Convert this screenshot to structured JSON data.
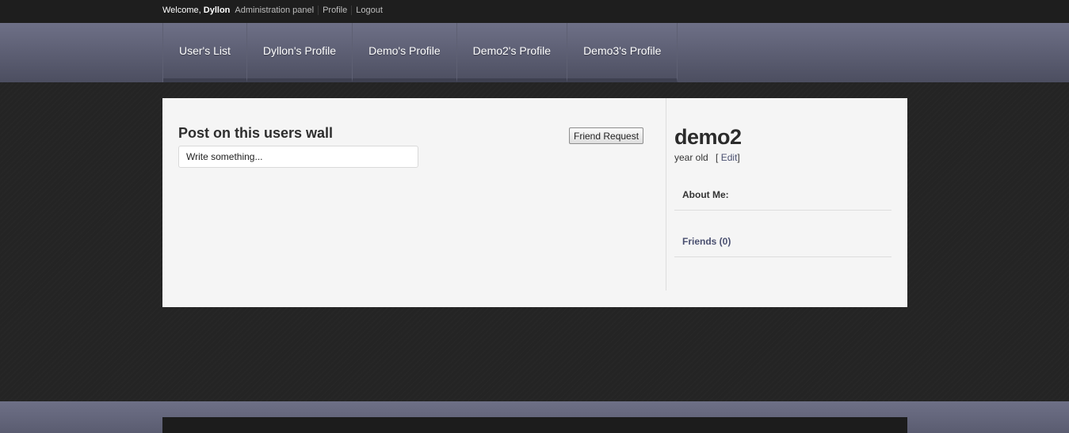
{
  "topbar": {
    "welcome_prefix": "Welcome,",
    "welcome_user": "Dyllon",
    "links": [
      "Administration panel",
      "Profile",
      "Logout"
    ]
  },
  "nav": {
    "items": [
      "User's List",
      "Dyllon's Profile",
      "Demo's Profile",
      "Demo2's Profile",
      "Demo3's Profile"
    ]
  },
  "wall": {
    "title": "Post on this users wall",
    "input_placeholder": "Write something...",
    "friend_request_label": "Friend Request"
  },
  "profile": {
    "username": "demo2",
    "age_text": "year old",
    "edit_open": "[",
    "edit_label": "Edit",
    "edit_close": "]",
    "about_label": "About Me:",
    "friends_label": "Friends (0)"
  }
}
